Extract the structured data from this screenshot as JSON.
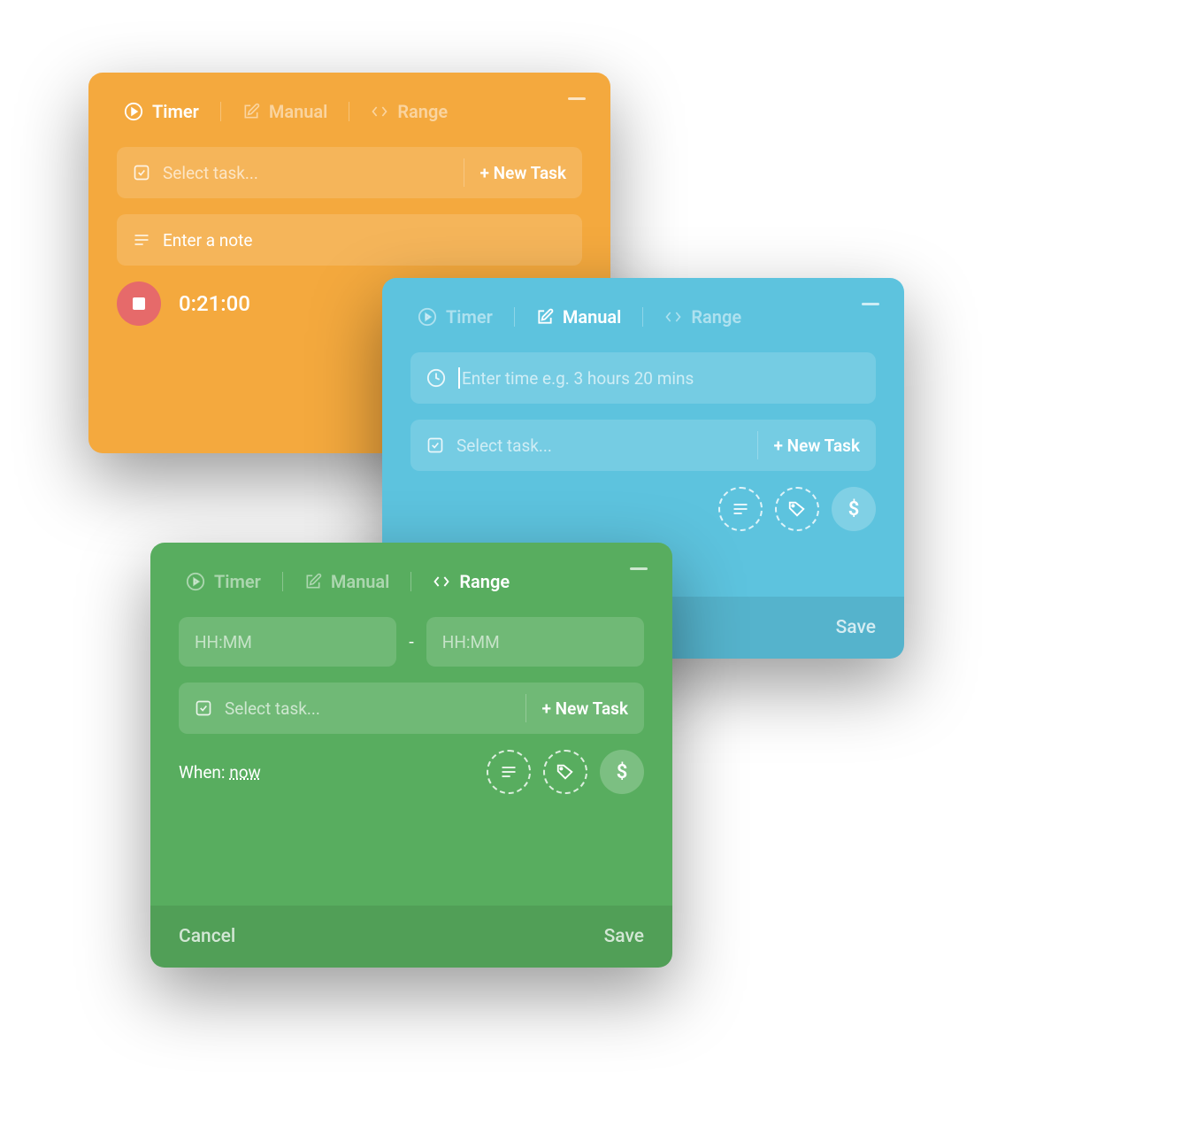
{
  "tabs": {
    "timer": "Timer",
    "manual": "Manual",
    "range": "Range"
  },
  "task": {
    "placeholder": "Select task...",
    "new": "+ New Task"
  },
  "orange": {
    "note_placeholder": "Enter a note",
    "elapsed": "0:21:00"
  },
  "blue": {
    "time_placeholder": "Enter time e.g. 3 hours 20 mins",
    "save": "Save"
  },
  "green": {
    "hhmm": "HH:MM",
    "when_label": "When:",
    "when_value": "now",
    "cancel": "Cancel",
    "save": "Save"
  },
  "icons": {
    "dollar": "$"
  }
}
